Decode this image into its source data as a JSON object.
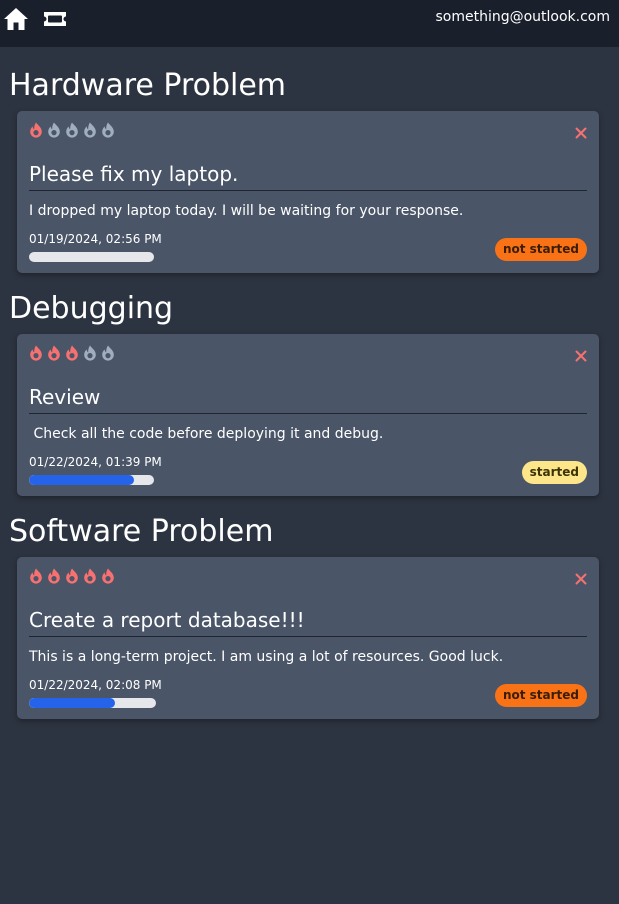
{
  "header": {
    "user_email": "something@outlook.com",
    "home_icon": "home-icon",
    "tickets_icon": "ticket-icon"
  },
  "colors": {
    "flame_active": "#f87171",
    "flame_inactive": "#a0aec0",
    "close": "#f87171",
    "not_started": "#f97316",
    "started": "#fde68a",
    "progress_fill": "#2563eb",
    "progress_track": "#e5e7eb"
  },
  "groups": [
    {
      "title": "Hardware Problem",
      "ticket": {
        "priority": 1,
        "priority_max": 5,
        "title": "Please fix my laptop.",
        "description": "I dropped my laptop today. I will be waiting for your response.",
        "date": "01/19/2024, 02:56 PM",
        "progress": 0,
        "status": "not started"
      }
    },
    {
      "title": "Debugging",
      "ticket": {
        "priority": 3,
        "priority_max": 5,
        "title": "Review",
        "description": " Check all the code before deploying it and debug.",
        "date": "01/22/2024, 01:39 PM",
        "progress": 0.84,
        "status": "started"
      }
    },
    {
      "title": "Software Problem",
      "ticket": {
        "priority": 5,
        "priority_max": 5,
        "title": "Create a report database!!!",
        "description": "This is a long-term project. I am using a lot of resources. Good luck.",
        "date": "01/22/2024, 02:08 PM",
        "progress": 0.68,
        "status": "not started"
      }
    }
  ]
}
